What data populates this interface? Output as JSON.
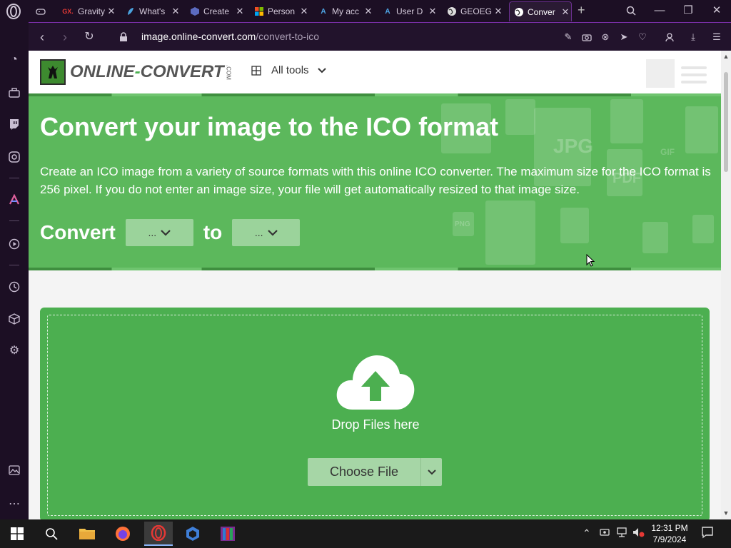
{
  "browser": {
    "tabs": [
      {
        "label": "",
        "icon": "gamepad-icon"
      },
      {
        "label": "Gravity",
        "prefix": "GX.",
        "icon": "gx-icon"
      },
      {
        "label": "What's",
        "icon": "bird-icon"
      },
      {
        "label": "Create",
        "icon": "hexagon-icon"
      },
      {
        "label": "Person",
        "icon": "microsoft-icon"
      },
      {
        "label": "My acc",
        "icon": "appwrite-icon"
      },
      {
        "label": "User D",
        "icon": "appwrite-icon"
      },
      {
        "label": "GEOEG",
        "icon": "globe-icon"
      },
      {
        "label": "Conver",
        "icon": "globe-icon",
        "active": true
      }
    ],
    "url_domain": "image.online-convert.com",
    "url_path": "/convert-to-ico"
  },
  "site": {
    "logo_part1": "ONLINE",
    "logo_dash": "-",
    "logo_part2": "CONVERT",
    "logo_suffix": ".COM",
    "all_tools_label": "All tools"
  },
  "hero": {
    "title": "Convert your image to the ICO format",
    "description": "Create an ICO image from a variety of source formats with this online ICO converter. The maximum size for the ICO format is 256 pixel. If you do not enter an image size, your file will get automatically resized to that image size.",
    "convert_label": "Convert",
    "from_value": "...",
    "to_label": "to",
    "to_value": "...",
    "bg_labels": [
      "JPG",
      "PDF",
      "PNG",
      "GIF"
    ]
  },
  "upload": {
    "drop_text": "Drop Files here",
    "choose_label": "Choose File"
  },
  "taskbar": {
    "time": "12:31 PM",
    "date": "7/9/2024"
  },
  "colors": {
    "accent_green": "#5cb85c",
    "upload_green": "#4caf50",
    "opera_purple": "#7a2fa8"
  }
}
